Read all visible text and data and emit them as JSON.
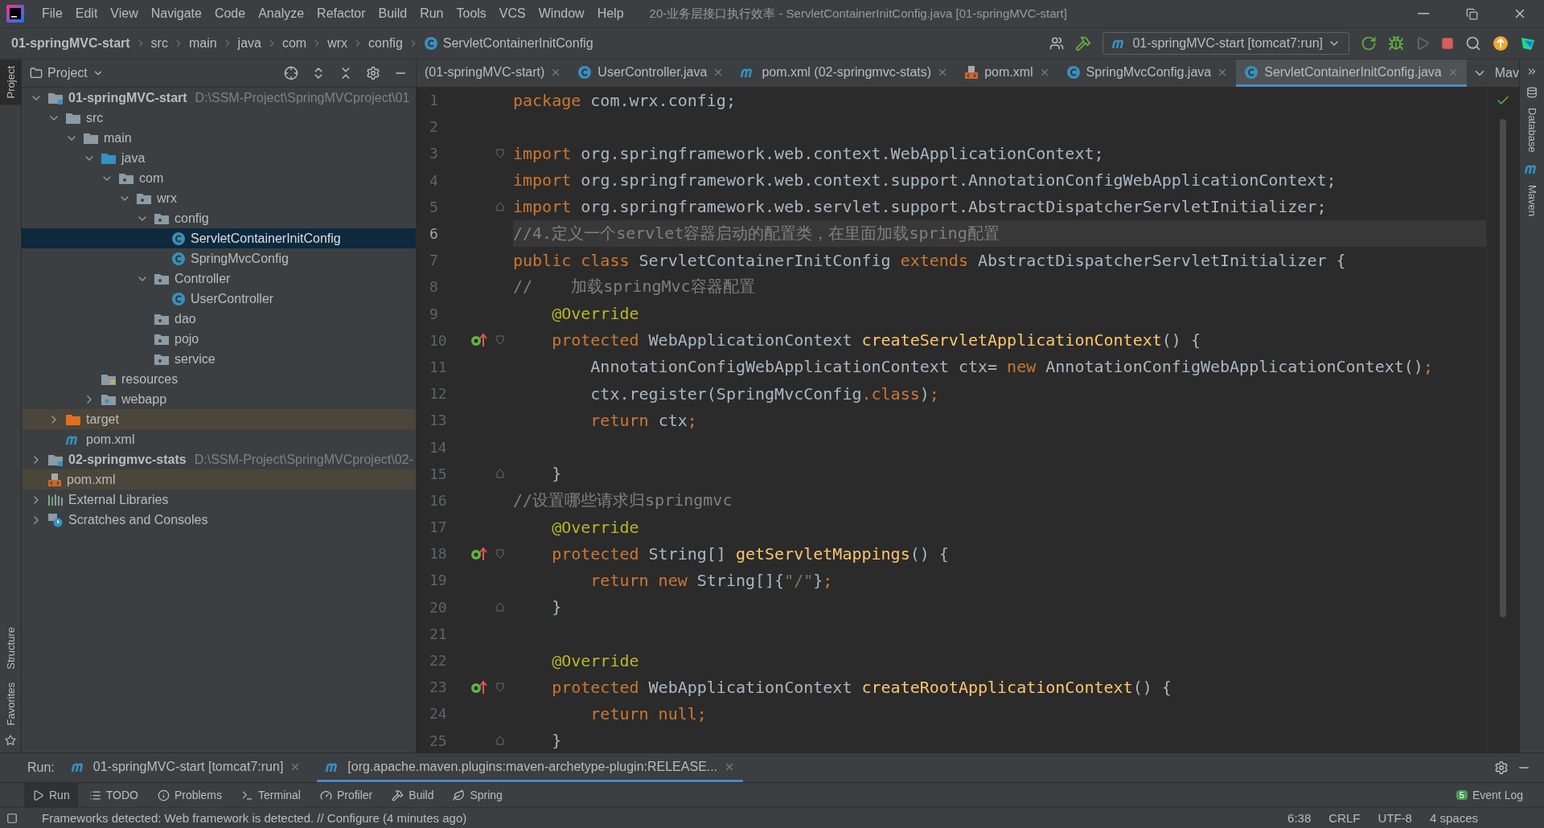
{
  "title_bar": {
    "menu": [
      "File",
      "Edit",
      "View",
      "Navigate",
      "Code",
      "Analyze",
      "Refactor",
      "Build",
      "Run",
      "Tools",
      "VCS",
      "Window",
      "Help"
    ],
    "title": "20-业务层接口执行效率 - ServletContainerInitConfig.java [01-springMVC-start]"
  },
  "breadcrumbs": [
    {
      "label": "01-springMVC-start",
      "kind": "module"
    },
    {
      "label": "src",
      "kind": "dir"
    },
    {
      "label": "main",
      "kind": "dir"
    },
    {
      "label": "java",
      "kind": "dir"
    },
    {
      "label": "com",
      "kind": "dir"
    },
    {
      "label": "wrx",
      "kind": "dir"
    },
    {
      "label": "config",
      "kind": "dir"
    },
    {
      "label": "ServletContainerInitConfig",
      "kind": "class"
    }
  ],
  "run_config": "01-springMVC-start [tomcat7:run]",
  "side_tools_left": [
    {
      "label": "Project",
      "selected": true
    },
    {
      "label": "Structure",
      "selected": false
    },
    {
      "label": "Favorites",
      "selected": false
    }
  ],
  "side_tools_right": [
    {
      "label": "Database"
    },
    {
      "label": "Maven"
    }
  ],
  "project_panel": {
    "title": "Project",
    "tree": [
      {
        "label": "01-springMVC-start",
        "path": "D:\\SSM-Project\\SpringMVCproject\\01",
        "kind": "module",
        "expanded": true,
        "selected": false,
        "excluded": false,
        "children": [
          {
            "label": "src",
            "kind": "folder",
            "expanded": true,
            "selected": false,
            "excluded": false,
            "children": [
              {
                "label": "main",
                "kind": "folder",
                "expanded": true,
                "selected": false,
                "excluded": false,
                "children": [
                  {
                    "label": "java",
                    "kind": "source",
                    "expanded": true,
                    "selected": false,
                    "excluded": false,
                    "children": [
                      {
                        "label": "com",
                        "kind": "package",
                        "expanded": true,
                        "selected": false,
                        "excluded": false,
                        "children": [
                          {
                            "label": "wrx",
                            "kind": "package",
                            "expanded": true,
                            "selected": false,
                            "excluded": false,
                            "children": [
                              {
                                "label": "config",
                                "kind": "package",
                                "expanded": true,
                                "selected": false,
                                "excluded": false,
                                "children": [
                                  {
                                    "label": "ServletContainerInitConfig",
                                    "kind": "class",
                                    "selected": true,
                                    "excluded": false
                                  },
                                  {
                                    "label": "SpringMvcConfig",
                                    "kind": "class",
                                    "selected": false,
                                    "excluded": false
                                  }
                                ]
                              },
                              {
                                "label": "Controller",
                                "kind": "package",
                                "expanded": true,
                                "selected": false,
                                "excluded": false,
                                "children": [
                                  {
                                    "label": "UserController",
                                    "kind": "class",
                                    "selected": false,
                                    "excluded": false
                                  }
                                ]
                              },
                              {
                                "label": "dao",
                                "kind": "package",
                                "selected": false,
                                "excluded": false
                              },
                              {
                                "label": "pojo",
                                "kind": "package",
                                "selected": false,
                                "excluded": false
                              },
                              {
                                "label": "service",
                                "kind": "package",
                                "selected": false,
                                "excluded": false
                              }
                            ]
                          }
                        ]
                      }
                    ]
                  },
                  {
                    "label": "resources",
                    "kind": "resources",
                    "selected": false,
                    "excluded": false
                  },
                  {
                    "label": "webapp",
                    "kind": "web",
                    "expanded": false,
                    "selected": false,
                    "excluded": false
                  }
                ]
              }
            ]
          },
          {
            "label": "target",
            "kind": "output",
            "expanded": false,
            "selected": false,
            "excluded": true
          },
          {
            "label": "pom.xml",
            "kind": "maven",
            "selected": false,
            "excluded": false
          }
        ]
      },
      {
        "label": "02-springmvc-stats",
        "path": "D:\\SSM-Project\\SpringMVCproject\\02-",
        "kind": "module",
        "expanded": false,
        "selected": false,
        "excluded": false
      },
      {
        "label": "pom.xml",
        "kind": "xml",
        "selected": false,
        "excluded": true
      },
      {
        "label": "External Libraries",
        "kind": "libraries",
        "expanded": false,
        "selected": false,
        "excluded": false
      },
      {
        "label": "Scratches and Consoles",
        "kind": "scratches",
        "expanded": false,
        "selected": false,
        "excluded": false
      }
    ]
  },
  "editor_tabs": [
    {
      "label": "(01-springMVC-start)",
      "selected": false
    },
    {
      "label": "UserController.java",
      "kind": "class",
      "selected": false
    },
    {
      "label": "pom.xml (02-springmvc-stats)",
      "kind": "maven",
      "selected": false
    },
    {
      "label": "pom.xml",
      "kind": "xml",
      "selected": false
    },
    {
      "label": "SpringMvcConfig.java",
      "kind": "class",
      "selected": false
    },
    {
      "label": "ServletContainerInitConfig.java",
      "kind": "class",
      "selected": true
    }
  ],
  "maven_stub": "Mav",
  "code_lines": [
    {
      "number": "1",
      "current": false,
      "tokens": [
        {
          "kind": "kw",
          "text": "package "
        },
        {
          "kind": "plain",
          "text": "com.wrx.config;"
        }
      ]
    },
    {
      "number": "2",
      "current": false
    },
    {
      "number": "3",
      "current": false,
      "gutter": [
        {
          "kind": "fold_start"
        }
      ],
      "tokens": [
        {
          "kind": "kw",
          "text": "import "
        },
        {
          "kind": "plain",
          "text": "org.springframework.web.context.WebApplicationContext;"
        }
      ]
    },
    {
      "number": "4",
      "current": false,
      "tokens": [
        {
          "kind": "kw",
          "text": "import "
        },
        {
          "kind": "plain",
          "text": "org.springframework.web.context.support.AnnotationConfigWebApplicationContext;"
        }
      ]
    },
    {
      "number": "5",
      "current": false,
      "gutter": [
        {
          "kind": "fold_end"
        }
      ],
      "tokens": [
        {
          "kind": "kw",
          "text": "import "
        },
        {
          "kind": "plain",
          "text": "org.springframework.web.servlet.support.AbstractDispatcherServletInitializer;"
        }
      ]
    },
    {
      "number": "6",
      "current": true,
      "tokens": [
        {
          "kind": "comment",
          "text": "//4.定义一个servlet容器启动的配置类，在里面加载spring配置"
        }
      ]
    },
    {
      "number": "7",
      "current": false,
      "tokens": [
        {
          "kind": "kw",
          "text": "public class "
        },
        {
          "kind": "plain",
          "text": "ServletContainerInitConfig "
        },
        {
          "kind": "kw",
          "text": "extends "
        },
        {
          "kind": "plain",
          "text": "AbstractDispatcherServletInitializer {"
        }
      ]
    },
    {
      "number": "8",
      "current": false,
      "tokens": [
        {
          "kind": "comment",
          "text": "//    加载springMvc容器配置"
        }
      ]
    },
    {
      "number": "9",
      "current": false,
      "tokens": [
        {
          "kind": "ann",
          "text": "    @Override"
        }
      ]
    },
    {
      "number": "10",
      "current": false,
      "gutter": [
        {
          "kind": "implements"
        },
        {
          "kind": "fold_start"
        }
      ],
      "tokens": [
        {
          "kind": "kw",
          "text": "    protected "
        },
        {
          "kind": "plain",
          "text": "WebApplicationContext "
        },
        {
          "kind": "method",
          "text": "createServletApplicationContext"
        },
        {
          "kind": "plain",
          "text": "() {"
        }
      ]
    },
    {
      "number": "11",
      "current": false,
      "tokens": [
        {
          "kind": "plain",
          "text": "        AnnotationConfigWebApplicationContext ctx= "
        },
        {
          "kind": "kw",
          "text": "new "
        },
        {
          "kind": "plain",
          "text": "AnnotationConfigWebApplicationContext()"
        },
        {
          "kind": "kw",
          "text": ";"
        }
      ]
    },
    {
      "number": "12",
      "current": false,
      "tokens": [
        {
          "kind": "plain",
          "text": "        ctx.register(SpringMvcConfig"
        },
        {
          "kind": "kw",
          "text": ".class"
        },
        {
          "kind": "plain",
          "text": ")"
        },
        {
          "kind": "kw",
          "text": ";"
        }
      ]
    },
    {
      "number": "13",
      "current": false,
      "tokens": [
        {
          "kind": "kw",
          "text": "        return "
        },
        {
          "kind": "plain",
          "text": "ctx"
        },
        {
          "kind": "kw",
          "text": ";"
        }
      ]
    },
    {
      "number": "14",
      "current": false
    },
    {
      "number": "15",
      "current": false,
      "gutter": [
        {
          "kind": "fold_end"
        }
      ],
      "tokens": [
        {
          "kind": "plain",
          "text": "    }"
        }
      ]
    },
    {
      "number": "16",
      "current": false,
      "tokens": [
        {
          "kind": "comment",
          "text": "//设置哪些请求归springmvc"
        }
      ]
    },
    {
      "number": "17",
      "current": false,
      "tokens": [
        {
          "kind": "ann",
          "text": "    @Override"
        }
      ]
    },
    {
      "number": "18",
      "current": false,
      "gutter": [
        {
          "kind": "implements"
        },
        {
          "kind": "fold_start"
        }
      ],
      "tokens": [
        {
          "kind": "kw",
          "text": "    protected "
        },
        {
          "kind": "plain",
          "text": "String[] "
        },
        {
          "kind": "method",
          "text": "getServletMappings"
        },
        {
          "kind": "plain",
          "text": "() {"
        }
      ]
    },
    {
      "number": "19",
      "current": false,
      "tokens": [
        {
          "kind": "kw",
          "text": "        return new "
        },
        {
          "kind": "plain",
          "text": "String[]{"
        },
        {
          "kind": "str",
          "text": "\"/\""
        },
        {
          "kind": "plain",
          "text": "}"
        },
        {
          "kind": "kw",
          "text": ";"
        }
      ]
    },
    {
      "number": "20",
      "current": false,
      "gutter": [
        {
          "kind": "fold_end"
        }
      ],
      "tokens": [
        {
          "kind": "plain",
          "text": "    }"
        }
      ]
    },
    {
      "number": "21",
      "current": false
    },
    {
      "number": "22",
      "current": false,
      "tokens": [
        {
          "kind": "ann",
          "text": "    @Override"
        }
      ]
    },
    {
      "number": "23",
      "current": false,
      "gutter": [
        {
          "kind": "implements"
        },
        {
          "kind": "fold_start"
        }
      ],
      "tokens": [
        {
          "kind": "kw",
          "text": "    protected "
        },
        {
          "kind": "plain",
          "text": "WebApplicationContext "
        },
        {
          "kind": "method",
          "text": "createRootApplicationContext"
        },
        {
          "kind": "plain",
          "text": "() {"
        }
      ]
    },
    {
      "number": "24",
      "current": false,
      "tokens": [
        {
          "kind": "kw",
          "text": "        return null;"
        }
      ]
    },
    {
      "number": "25",
      "current": false,
      "gutter": [
        {
          "kind": "fold_end"
        }
      ],
      "tokens": [
        {
          "kind": "plain",
          "text": "    }"
        }
      ]
    }
  ],
  "run_bar": {
    "label": "Run:",
    "tabs": [
      {
        "label": "01-springMVC-start [tomcat7:run]",
        "selected": false
      },
      {
        "label": "[org.apache.maven.plugins:maven-archetype-plugin:RELEASE...",
        "selected": true
      }
    ]
  },
  "tool_tabs": [
    {
      "label": "Run",
      "kind": "run",
      "selected": true
    },
    {
      "label": "TODO",
      "kind": "todo",
      "selected": false
    },
    {
      "label": "Problems",
      "kind": "problems",
      "selected": false
    },
    {
      "label": "Terminal",
      "kind": "terminal",
      "selected": false
    },
    {
      "label": "Profiler",
      "kind": "profiler",
      "selected": false
    },
    {
      "label": "Build",
      "kind": "build",
      "selected": false
    },
    {
      "label": "Spring",
      "kind": "spring",
      "selected": false
    }
  ],
  "event_log": {
    "label": "Event Log",
    "count": "5"
  },
  "status_bar": {
    "message": "Frameworks detected: Web framework is detected. // Configure (4 minutes ago)",
    "items": [
      "6:38",
      "CRLF",
      "UTF-8",
      "4 spaces"
    ]
  }
}
